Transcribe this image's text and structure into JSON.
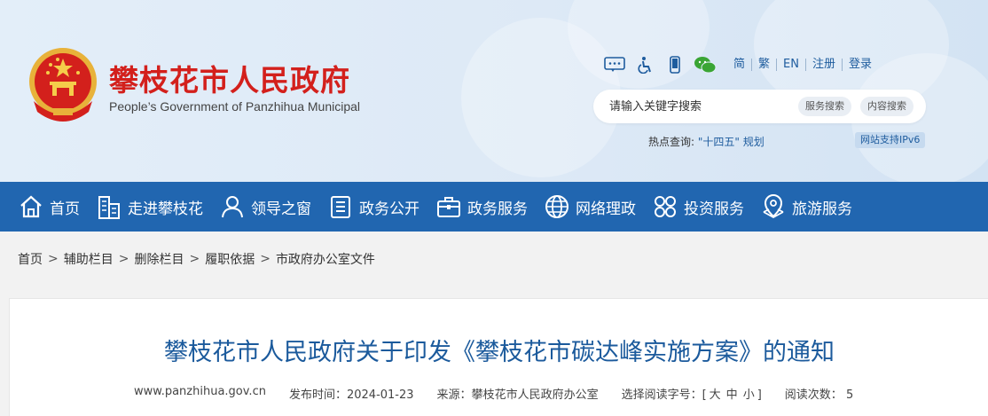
{
  "header": {
    "title": "攀枝花市人民政府",
    "subtitle": "People’s Government of Panzhihua Municipal"
  },
  "toolbar": {
    "icons": [
      "message-icon",
      "accessibility-icon",
      "mobile-icon",
      "wechat-icon"
    ],
    "links": [
      "简",
      "繁",
      "EN",
      "注册",
      "登录"
    ]
  },
  "search": {
    "placeholder": "请输入关键字搜索",
    "service_button": "服务搜索",
    "content_button": "内容搜索",
    "hot_label": "热点查询: ",
    "hot_link": "\"十四五\" 规划",
    "ipv6": "网站支持IPv6"
  },
  "nav": {
    "items": [
      {
        "label": "首页",
        "icon": "home-icon"
      },
      {
        "label": "走进攀枝花",
        "icon": "buildings-icon"
      },
      {
        "label": "领导之窗",
        "icon": "person-icon"
      },
      {
        "label": "政务公开",
        "icon": "document-icon"
      },
      {
        "label": "政务服务",
        "icon": "briefcase-icon"
      },
      {
        "label": "网络理政",
        "icon": "globe-icon"
      },
      {
        "label": "投资服务",
        "icon": "grid-icon"
      },
      {
        "label": "旅游服务",
        "icon": "map-pin-icon"
      }
    ]
  },
  "breadcrumb": {
    "items": [
      "首页",
      "辅助栏目",
      "删除栏目",
      "履职依据",
      "市政府办公室文件"
    ],
    "separator": ">"
  },
  "article": {
    "title": "攀枝花市人民政府关于印发《攀枝花市碳达峰实施方案》的通知",
    "site": "www.panzhihua.gov.cn",
    "publish_label": "发布时间：",
    "publish_date": "2024-01-23",
    "source_label": "来源：",
    "source": "攀枝花市人民政府办公室",
    "font_label": "选择阅读字号：[",
    "font_large": "大",
    "font_medium": "中",
    "font_small": "小",
    "font_close": "]",
    "reads_label": "阅读次数：",
    "reads": "5"
  },
  "colors": {
    "nav_bg": "#2166b0",
    "title_red": "#d3201c",
    "link_blue": "#1e5c9e",
    "article_title": "#1b5a9c"
  }
}
